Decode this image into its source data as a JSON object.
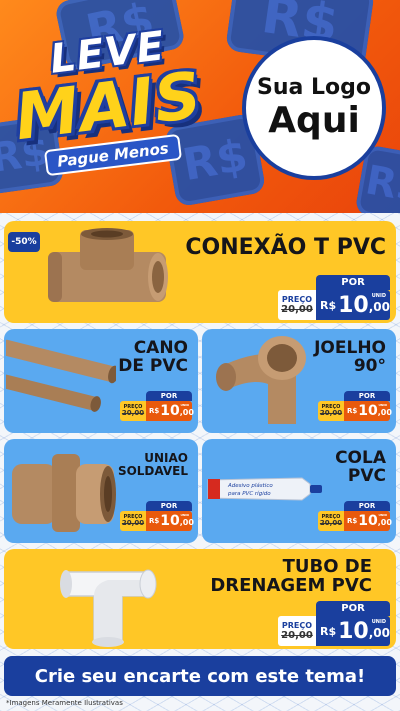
{
  "header": {
    "promo_line1": "LEVE",
    "promo_line2": "MAIS",
    "promo_line3": "Pague Menos",
    "logo_line1": "Sua Logo",
    "logo_line2": "Aqui",
    "coin_symbol": "R$"
  },
  "colors": {
    "header_orange": "#f25a0c",
    "brand_blue": "#1a3f9e",
    "card_yellow": "#ffc726",
    "card_blue": "#5aa9f0",
    "price_orange": "#e9590c"
  },
  "products": [
    {
      "name": "CONEXÃO T PVC",
      "discount_badge": "-50%",
      "por_label": "POR",
      "preco_label": "PREÇO",
      "old_price": "20,00",
      "currency": "R$",
      "price_int": "10",
      "price_cents": ",00",
      "unit": "UNID",
      "icon": "pvc-tee-connector-icon"
    },
    {
      "name_line1": "CANO",
      "name_line2": "DE PVC",
      "por_label": "POR",
      "preco_label": "PREÇO",
      "old_price": "20,00",
      "currency": "R$",
      "price_int": "10",
      "price_cents": ",00",
      "unit": "UNID",
      "icon": "pvc-pipes-icon"
    },
    {
      "name_line1": "JOELHO",
      "name_line2": "90°",
      "por_label": "POR",
      "preco_label": "PREÇO",
      "old_price": "20,00",
      "currency": "R$",
      "price_int": "10",
      "price_cents": ",00",
      "unit": "UNID",
      "icon": "pvc-elbow-icon"
    },
    {
      "name_line1": "UNIAO",
      "name_line2": "SOLDAVEL",
      "por_label": "POR",
      "preco_label": "PREÇO",
      "old_price": "20,00",
      "currency": "R$",
      "price_int": "10",
      "price_cents": ",00",
      "unit": "UNID",
      "icon": "pvc-union-icon"
    },
    {
      "name_line1": "COLA",
      "name_line2": "PVC",
      "tube_text_line1": "Adesivo plástico",
      "tube_text_line2": "para PVC rígido",
      "por_label": "POR",
      "preco_label": "PREÇO",
      "old_price": "20,00",
      "currency": "R$",
      "price_int": "10",
      "price_cents": ",00",
      "unit": "UNID",
      "icon": "pvc-glue-tube-icon"
    },
    {
      "name_line1": "TUBO DE",
      "name_line2": "DRENAGEM PVC",
      "por_label": "POR",
      "preco_label": "PREÇO",
      "old_price": "20,00",
      "currency": "R$",
      "price_int": "10",
      "price_cents": ",00",
      "unit": "UNID",
      "icon": "white-drain-tee-icon"
    }
  ],
  "footer": {
    "cta": "Crie seu encarte com este tema!",
    "disclaimer": "*Imagens Meramente Ilustrativas"
  }
}
